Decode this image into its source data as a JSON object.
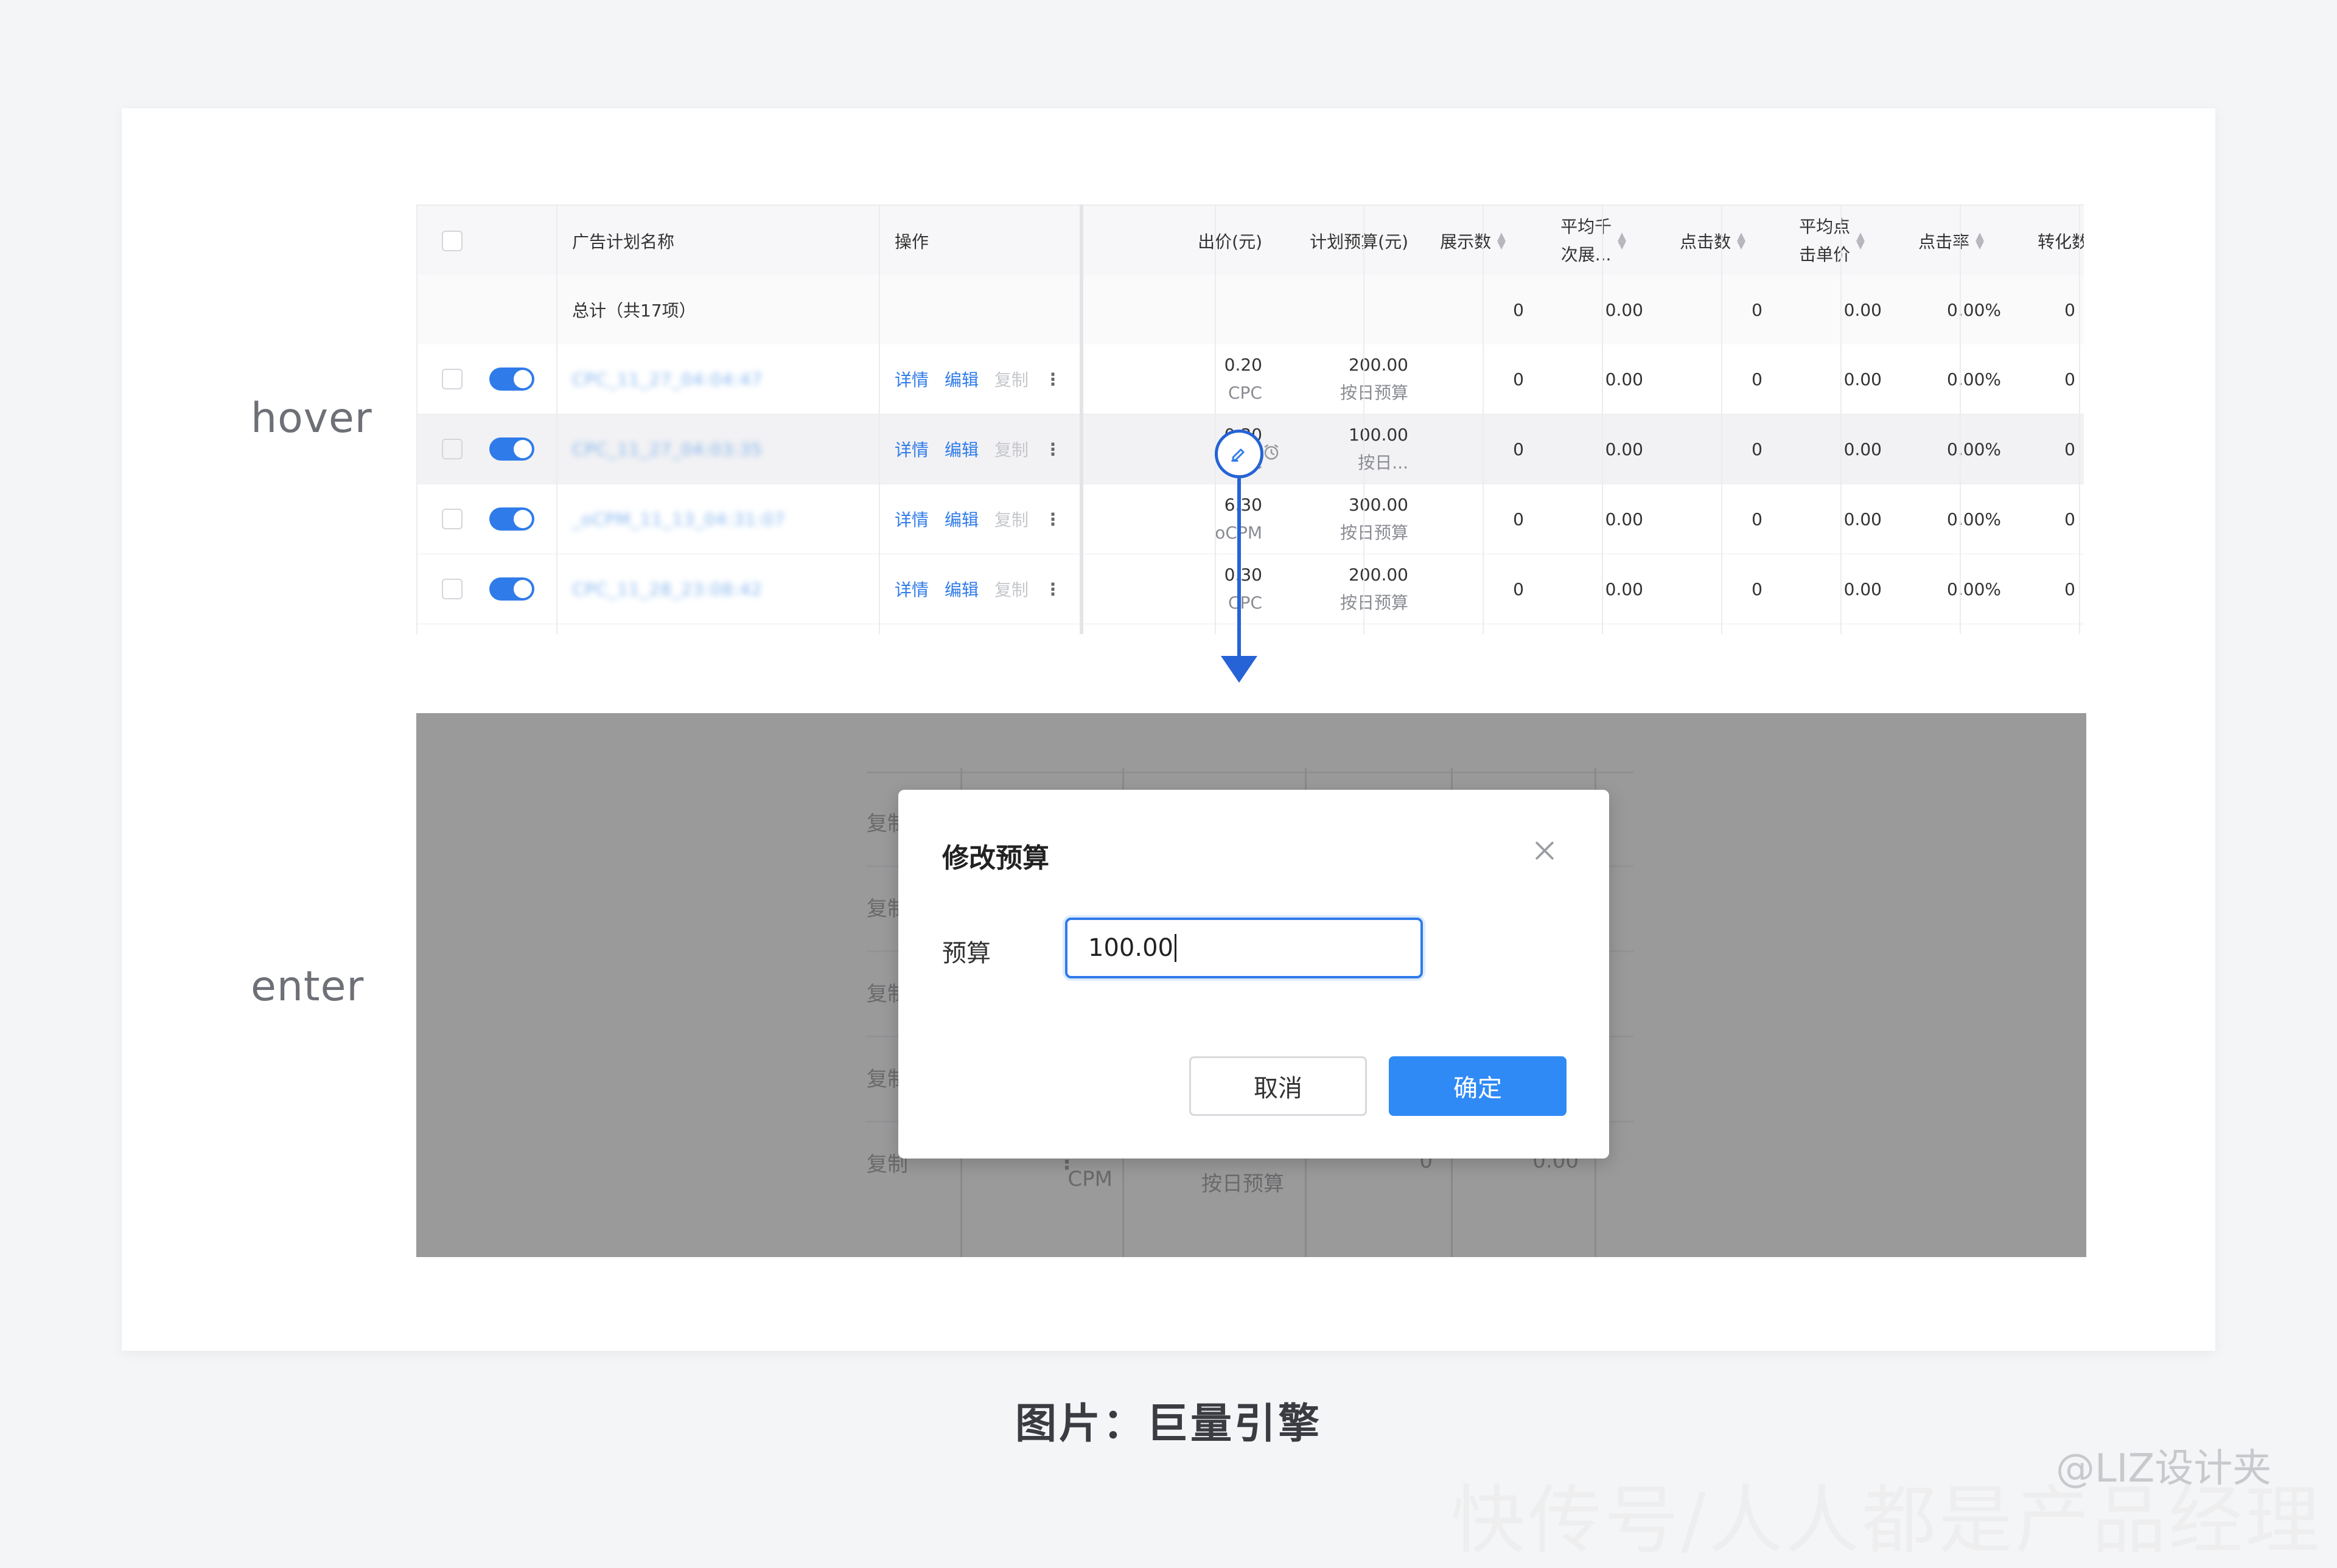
{
  "labels": {
    "hover": "hover",
    "enter": "enter"
  },
  "table": {
    "headers": {
      "name": "广告计划名称",
      "action": "操作",
      "bid": "出价(元)",
      "budget": "计划预算(元)",
      "impressions": "展示数",
      "cpm_l1": "平均千",
      "cpm_l2": "次展...",
      "clicks": "点击数",
      "cpc_l1": "平均点",
      "cpc_l2": "击单价",
      "ctr": "点击率",
      "conversions": "转化数"
    },
    "total": {
      "label": "总计（共17项）",
      "impressions": "0",
      "cpm": "0.00",
      "clicks": "0",
      "cpc": "0.00",
      "ctr": "0.00%",
      "conversions": "0"
    },
    "action_labels": {
      "detail": "详情",
      "edit": "编辑",
      "copy": "复制",
      "more": "⋮"
    },
    "rows": [
      {
        "name": "CPC_11_27_04:04:47",
        "bid": "0.20",
        "bid_type": "CPC",
        "budget": "200.00",
        "budget_type": "按日预算",
        "impressions": "0",
        "cpm": "0.00",
        "clicks": "0",
        "cpc": "0.00",
        "ctr": "0.00%",
        "conversions": "0"
      },
      {
        "name": "CPC_11_27_04:03:35",
        "bid": "0.30",
        "bid_type": "CPC",
        "budget": "100.00",
        "budget_type": "按日...",
        "impressions": "0",
        "cpm": "0.00",
        "clicks": "0",
        "cpc": "0.00",
        "ctr": "0.00%",
        "conversions": "0"
      },
      {
        "name": "_oCPM_11_13_04:31:07",
        "bid": "6.30",
        "bid_type": "oCPM",
        "budget": "300.00",
        "budget_type": "按日预算",
        "impressions": "0",
        "cpm": "0.00",
        "clicks": "0",
        "cpc": "0.00",
        "ctr": "0.00%",
        "conversions": "0"
      },
      {
        "name": "CPC_11_28_23:08:42",
        "bid": "0.30",
        "bid_type": "CPC",
        "budget": "200.00",
        "budget_type": "按日预算",
        "impressions": "0",
        "cpm": "0.00",
        "clicks": "0",
        "cpc": "0.00",
        "ctr": "0.00%",
        "conversions": "0"
      }
    ]
  },
  "background_table": {
    "copy_fragment": "复制",
    "bottom_bid_type": "CPM",
    "bottom_budget_type": "按日预算",
    "bottom_value1": "0",
    "bottom_value2": "0.00"
  },
  "modal": {
    "title": "修改预算",
    "field_label": "预算",
    "input_value": "100.00",
    "cancel": "取消",
    "confirm": "确定"
  },
  "caption": "图片：巨量引擎",
  "watermark": {
    "handle": "@LIZ设计夹",
    "site": "快传号/人人都是产品经理"
  },
  "colors": {
    "accent": "#2f7bea",
    "arrow": "#2563d6",
    "overlay": "#9a9a9b"
  }
}
